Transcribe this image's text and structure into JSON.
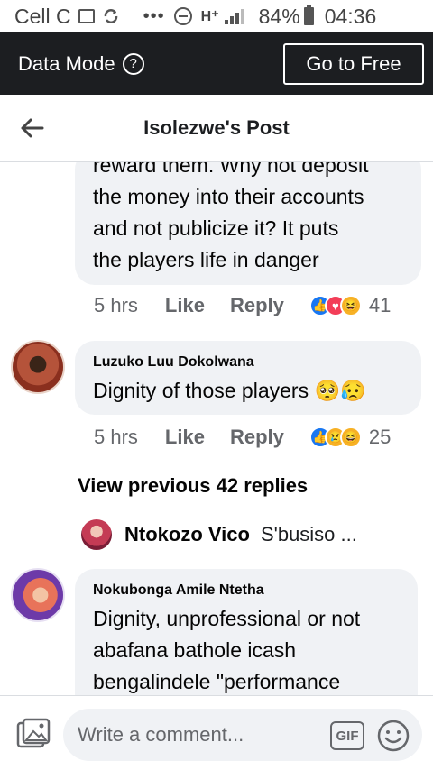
{
  "status_bar": {
    "carrier": "Cell C",
    "dots": "•••",
    "network": "H⁺",
    "battery_percent": "84%",
    "time": "04:36"
  },
  "data_bar": {
    "label": "Data Mode",
    "help_glyph": "?",
    "go_free": "Go to Free"
  },
  "header": {
    "title": "Isolezwe's Post"
  },
  "comments": [
    {
      "lines": [
        "reward them. Why not deposit",
        "the money into their accounts",
        "and not publicize it? It puts",
        "the players life in danger"
      ],
      "time": "5 hrs",
      "like": "Like",
      "reply": "Reply",
      "reactions": [
        "like",
        "love",
        "haha"
      ],
      "reaction_count": "41"
    },
    {
      "author": "Luzuko Luu Dokolwana",
      "text": "Dignity of those players 🥺😥",
      "time": "5 hrs",
      "like": "Like",
      "reply": "Reply",
      "reactions": [
        "like",
        "sad",
        "haha"
      ],
      "reaction_count": "25"
    },
    {
      "author": "Nokubonga Amile Ntetha",
      "lines": [
        "Dignity, unprofessional or not",
        "abafana bathole icash",
        "bengalindele \"performance"
      ]
    }
  ],
  "view_previous": "View previous 42 replies",
  "reply_preview": {
    "name": "Ntokozo Vico",
    "snippet": "S'busiso ..."
  },
  "composer": {
    "placeholder": "Write a comment...",
    "gif_label": "GIF"
  },
  "colors": {
    "data_bar_bg": "#1c1e21",
    "bubble_bg": "#f0f2f5",
    "meta_text": "#65676b",
    "like_blue": "#1877f2",
    "love_red": "#f33e58",
    "haha_yellow": "#f7b125"
  },
  "icons": [
    "sim-icon",
    "message-icon",
    "sync-icon",
    "data-saver-icon",
    "signal-icon",
    "battery-icon",
    "help-icon",
    "back-arrow-icon",
    "photo-icon",
    "gif-icon",
    "emoji-icon"
  ]
}
